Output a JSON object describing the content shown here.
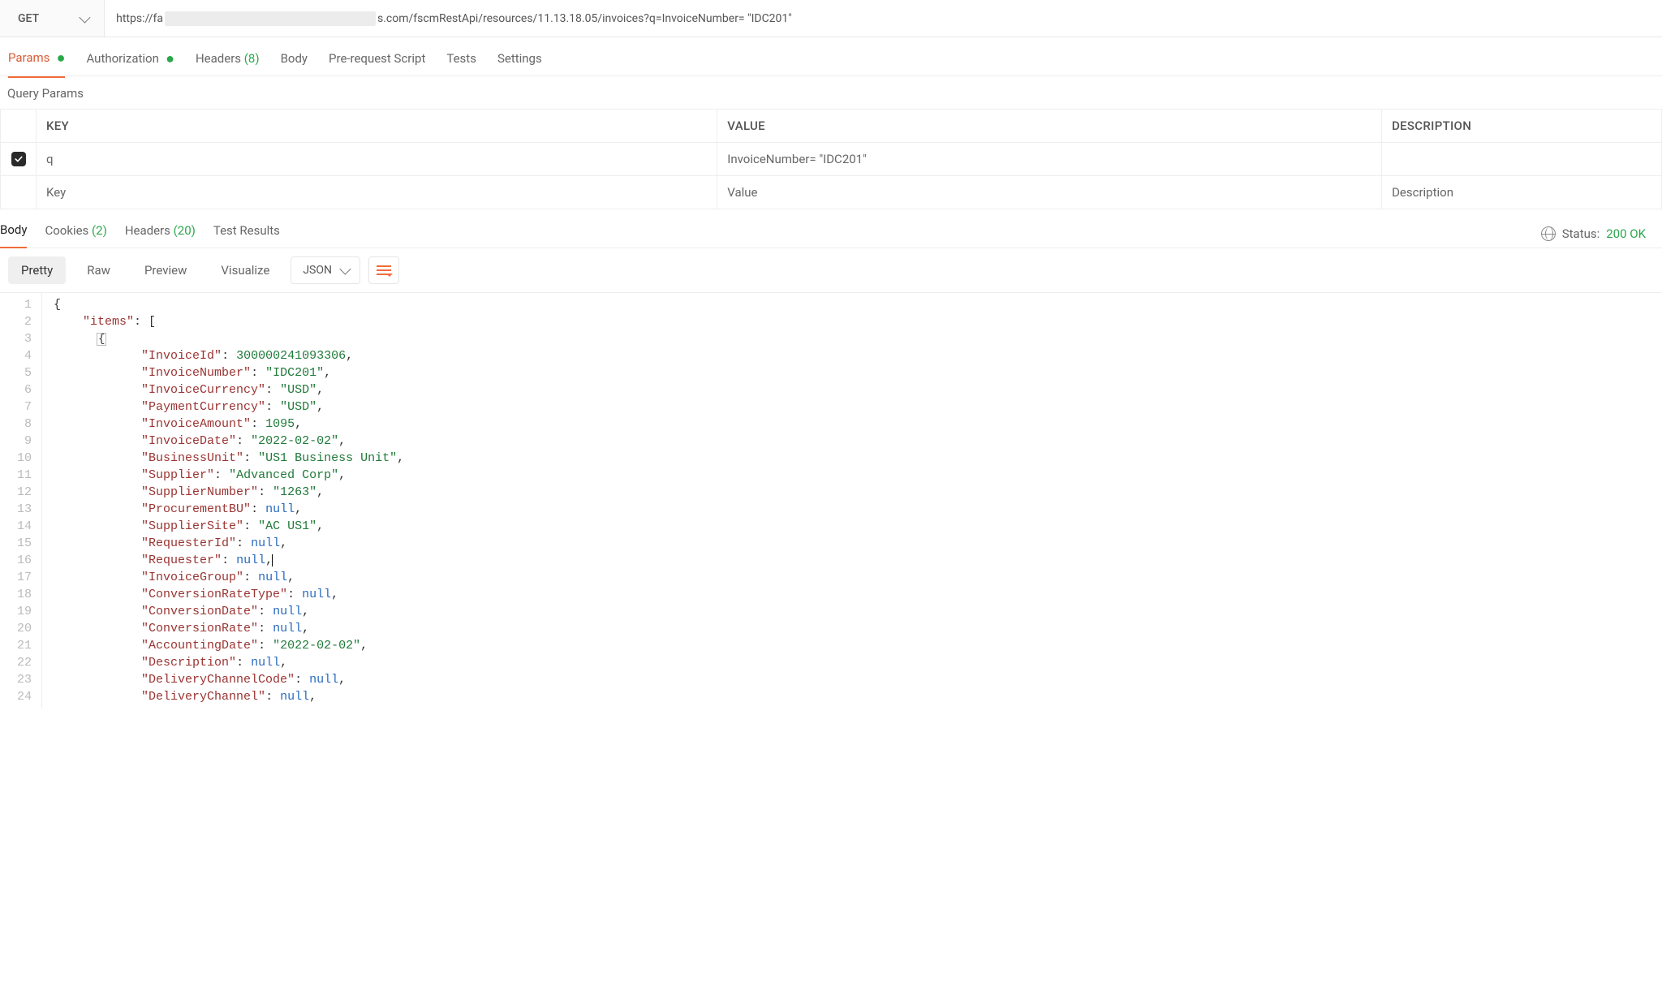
{
  "request": {
    "method": "GET",
    "url_prefix": "https://fa",
    "url_suffix": "s.com/fscmRestApi/resources/11.13.18.05/invoices?q=InvoiceNumber= \"IDC201\""
  },
  "req_tabs": {
    "params": {
      "label": "Params",
      "has_dot": true,
      "active": true
    },
    "authorization": {
      "label": "Authorization",
      "has_dot": true
    },
    "headers": {
      "label": "Headers",
      "count": "(8)"
    },
    "body": {
      "label": "Body"
    },
    "prereq": {
      "label": "Pre-request Script"
    },
    "tests": {
      "label": "Tests"
    },
    "settings": {
      "label": "Settings"
    }
  },
  "query_params": {
    "title": "Query Params",
    "headers": {
      "key": "KEY",
      "value": "VALUE",
      "description": "DESCRIPTION"
    },
    "rows": [
      {
        "checked": true,
        "key": "q",
        "value": "InvoiceNumber= \"IDC201\"",
        "description": ""
      }
    ],
    "placeholder": {
      "key": "Key",
      "value": "Value",
      "description": "Description"
    }
  },
  "resp_tabs": {
    "body": {
      "label": "Body",
      "active": true
    },
    "cookies": {
      "label": "Cookies",
      "count": "(2)"
    },
    "headers": {
      "label": "Headers",
      "count": "(20)"
    },
    "test_results": {
      "label": "Test Results"
    },
    "status_label": "Status:",
    "status_value": "200 OK"
  },
  "body_toolbar": {
    "pretty": "Pretty",
    "raw": "Raw",
    "preview": "Preview",
    "visualize": "Visualize",
    "format": "JSON"
  },
  "code": {
    "lines": [
      {
        "n": 1,
        "indent": 0,
        "raw": "{"
      },
      {
        "n": 2,
        "indent": 1,
        "key": "items",
        "raw_after": ": ["
      },
      {
        "n": 3,
        "indent": 2,
        "fold": "{"
      },
      {
        "n": 4,
        "indent": 3,
        "key": "InvoiceId",
        "type": "num",
        "val": "300000241093306",
        "comma": true
      },
      {
        "n": 5,
        "indent": 3,
        "key": "InvoiceNumber",
        "type": "str",
        "val": "IDC201",
        "comma": true
      },
      {
        "n": 6,
        "indent": 3,
        "key": "InvoiceCurrency",
        "type": "str",
        "val": "USD",
        "comma": true
      },
      {
        "n": 7,
        "indent": 3,
        "key": "PaymentCurrency",
        "type": "str",
        "val": "USD",
        "comma": true
      },
      {
        "n": 8,
        "indent": 3,
        "key": "InvoiceAmount",
        "type": "num",
        "val": "1095",
        "comma": true
      },
      {
        "n": 9,
        "indent": 3,
        "key": "InvoiceDate",
        "type": "str",
        "val": "2022-02-02",
        "comma": true
      },
      {
        "n": 10,
        "indent": 3,
        "key": "BusinessUnit",
        "type": "str",
        "val": "US1 Business Unit",
        "comma": true
      },
      {
        "n": 11,
        "indent": 3,
        "key": "Supplier",
        "type": "str",
        "val": "Advanced Corp",
        "comma": true
      },
      {
        "n": 12,
        "indent": 3,
        "key": "SupplierNumber",
        "type": "str",
        "val": "1263",
        "comma": true
      },
      {
        "n": 13,
        "indent": 3,
        "key": "ProcurementBU",
        "type": "null",
        "val": "null",
        "comma": true
      },
      {
        "n": 14,
        "indent": 3,
        "key": "SupplierSite",
        "type": "str",
        "val": "AC US1",
        "comma": true
      },
      {
        "n": 15,
        "indent": 3,
        "key": "RequesterId",
        "type": "null",
        "val": "null",
        "comma": true
      },
      {
        "n": 16,
        "indent": 3,
        "key": "Requester",
        "type": "null",
        "val": "null",
        "comma": true,
        "caret": true
      },
      {
        "n": 17,
        "indent": 3,
        "key": "InvoiceGroup",
        "type": "null",
        "val": "null",
        "comma": true
      },
      {
        "n": 18,
        "indent": 3,
        "key": "ConversionRateType",
        "type": "null",
        "val": "null",
        "comma": true
      },
      {
        "n": 19,
        "indent": 3,
        "key": "ConversionDate",
        "type": "null",
        "val": "null",
        "comma": true
      },
      {
        "n": 20,
        "indent": 3,
        "key": "ConversionRate",
        "type": "null",
        "val": "null",
        "comma": true
      },
      {
        "n": 21,
        "indent": 3,
        "key": "AccountingDate",
        "type": "str",
        "val": "2022-02-02",
        "comma": true
      },
      {
        "n": 22,
        "indent": 3,
        "key": "Description",
        "type": "null",
        "val": "null",
        "comma": true
      },
      {
        "n": 23,
        "indent": 3,
        "key": "DeliveryChannelCode",
        "type": "null",
        "val": "null",
        "comma": true
      },
      {
        "n": 24,
        "indent": 3,
        "key": "DeliveryChannel",
        "type": "null",
        "val": "null",
        "comma": true
      }
    ]
  }
}
